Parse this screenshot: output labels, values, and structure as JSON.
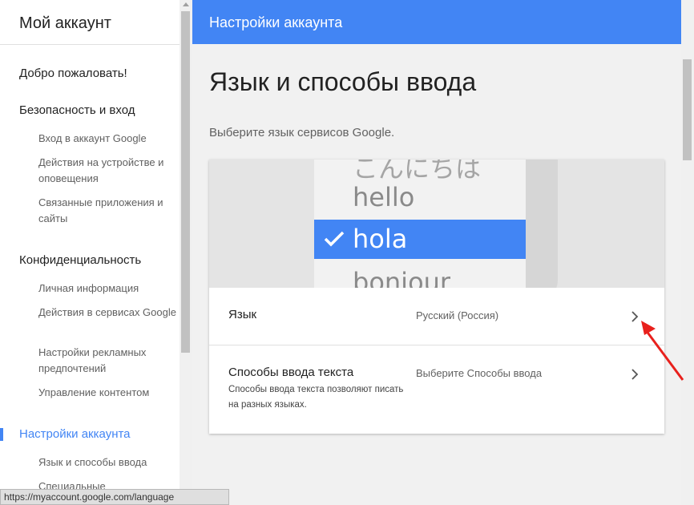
{
  "sidebar": {
    "title": "Мой аккаунт",
    "welcome": "Добро пожаловать!",
    "security": {
      "label": "Безопасность и вход",
      "items": [
        "Вход в аккаунт Google",
        "Действия на устройстве и оповещения",
        "Связанные приложения и сайты"
      ]
    },
    "privacy": {
      "label": "Конфиденциальность",
      "items": [
        "Личная информация",
        "Действия в сервисах Google",
        "Настройки рекламных предпочтений",
        "Управление контентом"
      ]
    },
    "account": {
      "label": "Настройки аккаунта",
      "items": [
        "Язык и способы ввода",
        "Специальные"
      ]
    }
  },
  "header": {
    "title": "Настройки аккаунта"
  },
  "main": {
    "title": "Язык и способы ввода",
    "subtitle": "Выберите язык сервисов Google."
  },
  "illustration": {
    "words": [
      "こんにちは",
      "hello",
      "hola",
      "bonjour"
    ],
    "selected": "hola"
  },
  "settings": {
    "language": {
      "label": "Язык",
      "value": "Русский (Россия)"
    },
    "input_methods": {
      "label": "Способы ввода текста",
      "description": "Способы ввода текста позволяют писать на разных языках.",
      "value": "Выберите Способы ввода"
    }
  },
  "status_bar": {
    "url": "https://myaccount.google.com/language"
  },
  "colors": {
    "accent": "#4285f4",
    "arrow": "#e8201c"
  }
}
